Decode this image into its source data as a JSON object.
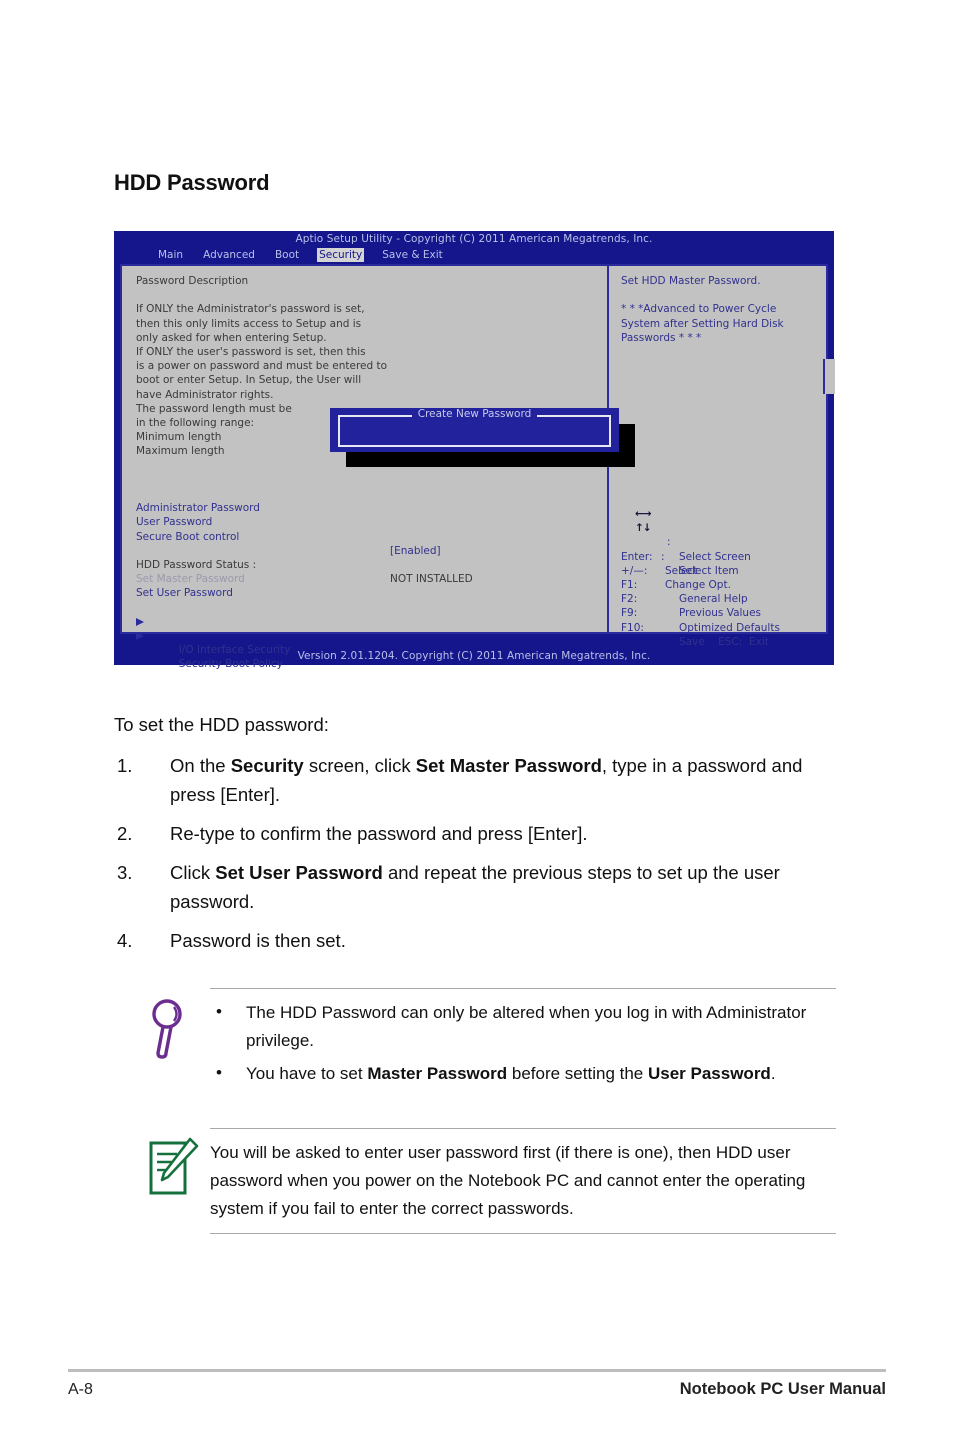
{
  "page": {
    "heading": "HDD Password"
  },
  "bios": {
    "title": "Aptio Setup Utility - Copyright (C) 2011 American Megatrends, Inc.",
    "version": "Version 2.01.1204. Copyright (C) 2011 American Megatrends, Inc.",
    "menu": [
      {
        "label": "Main",
        "active": false
      },
      {
        "label": "Advanced",
        "active": false
      },
      {
        "label": "Boot",
        "active": false
      },
      {
        "label": "Security",
        "active": true
      },
      {
        "label": "Save & Exit",
        "active": false
      }
    ],
    "left_panel": {
      "section_title": "Password Description",
      "description": [
        "If ONLY the Administrator's password is set,",
        "then this only limits access to Setup and is",
        "only asked for when entering Setup.",
        "If ONLY the user's password is set, then this",
        "is a power on password and must be entered to",
        "boot or enter Setup. In Setup, the User will",
        "have Administrator rights.",
        "The password length must be",
        "in the following range:",
        "Minimum length",
        "Maximum length"
      ],
      "items": [
        {
          "label": "Administrator Password",
          "value": "",
          "dim": false
        },
        {
          "label": "User Password",
          "value": "",
          "dim": false
        },
        {
          "label": "Secure Boot control",
          "value": "[Enabled]",
          "dim": false
        }
      ],
      "status": {
        "label": "HDD Password Status :",
        "value": "NOT INSTALLED"
      },
      "password_items": [
        {
          "label": "Set Master Password",
          "dim": true
        },
        {
          "label": "Set User Password",
          "dim": false
        }
      ],
      "submenus": [
        {
          "label": "I/O Interface Security"
        },
        {
          "label": "Security Boot Policy"
        }
      ]
    },
    "right_panel": {
      "help_title": "Set HDD Master Password.",
      "help_note": [
        "* * *Advanced to Power Cycle",
        "System after Setting Hard Disk",
        "Passwords * * *"
      ],
      "keys": [
        {
          "glyph": "←→",
          "key": "",
          "sep": ":",
          "action": "Select Screen"
        },
        {
          "glyph": "↑↓",
          "key": "",
          "sep": ":",
          "action": "Select Item"
        },
        {
          "glyph": "",
          "key": "Enter:",
          "sep": "",
          "action": "Select"
        },
        {
          "glyph": "",
          "key": "+/—:",
          "sep": "",
          "action": "Change Opt."
        },
        {
          "glyph": "",
          "key": "F1:",
          "sep": "",
          "action": "General Help"
        },
        {
          "glyph": "",
          "key": "F2:",
          "sep": "",
          "action": "Previous Values"
        },
        {
          "glyph": "",
          "key": "F9:",
          "sep": "",
          "action": "Optimized Defaults"
        },
        {
          "glyph": "",
          "key": "F10:",
          "sep": "",
          "action": "Save    ESC:  Exit"
        }
      ]
    },
    "dialog": {
      "title": "Create New Password"
    }
  },
  "instructions": {
    "intro": "To set the HDD password:",
    "steps": [
      {
        "num": "1.",
        "html": "On the <b>Security</b> screen, click <b>Set Master Password</b>, type in a password and press [Enter]."
      },
      {
        "num": "2.",
        "html": "Re-type to confirm the password and press [Enter]."
      },
      {
        "num": "3.",
        "html": "Click <b>Set User Password</b> and repeat the previous steps to set up the user password."
      },
      {
        "num": "4.",
        "html": "Password is then set."
      }
    ]
  },
  "tip_box": {
    "icon": "magnifier-icon",
    "bullets": [
      "The HDD Password can only be altered when you log in with Administrator privilege.",
      "You have to set <b>Master Password</b> before setting the <b>User Password</b>."
    ]
  },
  "note_box": {
    "icon": "notepad-pencil-icon",
    "text": "You will be asked to enter user password first (if there is one), then HDD user password when you power on the Notebook PC and cannot enter the operating system if you fail to enter the correct passwords."
  },
  "footer": {
    "page_number": "A-8",
    "manual_title": "Notebook PC User Manual"
  },
  "colors": {
    "bios_background": "#15158c",
    "bios_panel": "#c2c2c2",
    "bios_text": "#31318f",
    "bios_border": "#2b2b9e",
    "tip_icon": "#6b2e8f",
    "note_icon": "#15713c"
  }
}
